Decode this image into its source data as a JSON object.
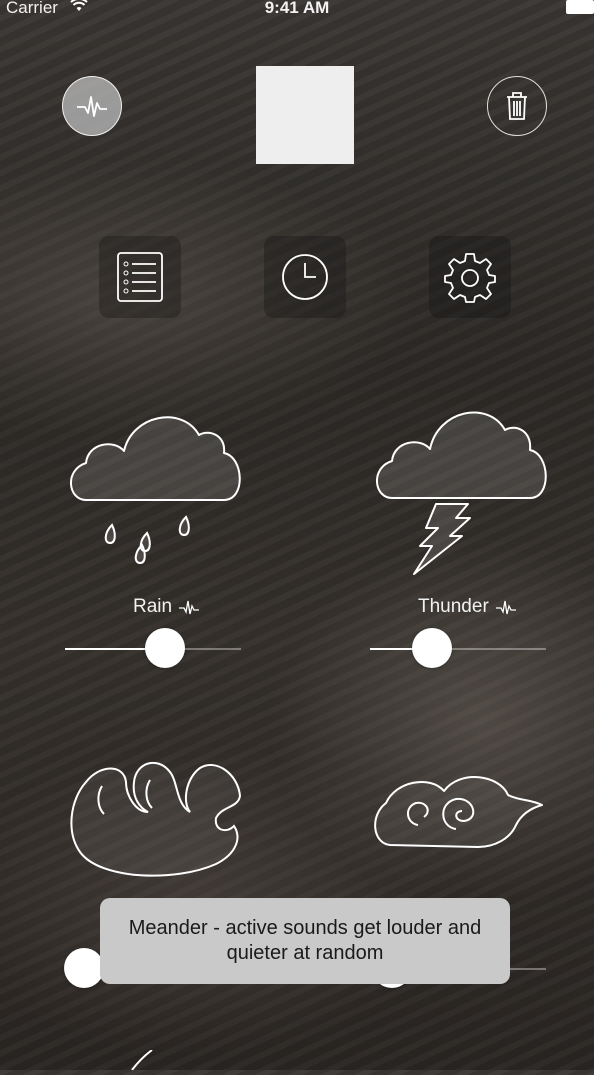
{
  "status_bar": {
    "carrier": "Carrier",
    "time": "9:41 AM"
  },
  "header": {
    "meander_icon": "waveform-icon",
    "trash_icon": "trash-icon"
  },
  "toolbar": {
    "list_icon": "list-icon",
    "timer_icon": "clock-icon",
    "settings_icon": "gear-icon"
  },
  "sounds": [
    {
      "label": "Rain",
      "icon": "rain-cloud-icon",
      "volume": 0.57
    },
    {
      "label": "Thunder",
      "icon": "thunder-cloud-icon",
      "volume": 0.35
    },
    {
      "label": "",
      "icon": "wave-icon",
      "volume": 0.1
    },
    {
      "label": "",
      "icon": "wind-icon",
      "volume": 0.1
    }
  ],
  "toast": {
    "text": "Meander - active sounds get louder and quieter at random"
  },
  "colors": {
    "accent": "#ffffff",
    "toast_bg": "#c9c9c9",
    "play_square": "#eeeeee"
  }
}
